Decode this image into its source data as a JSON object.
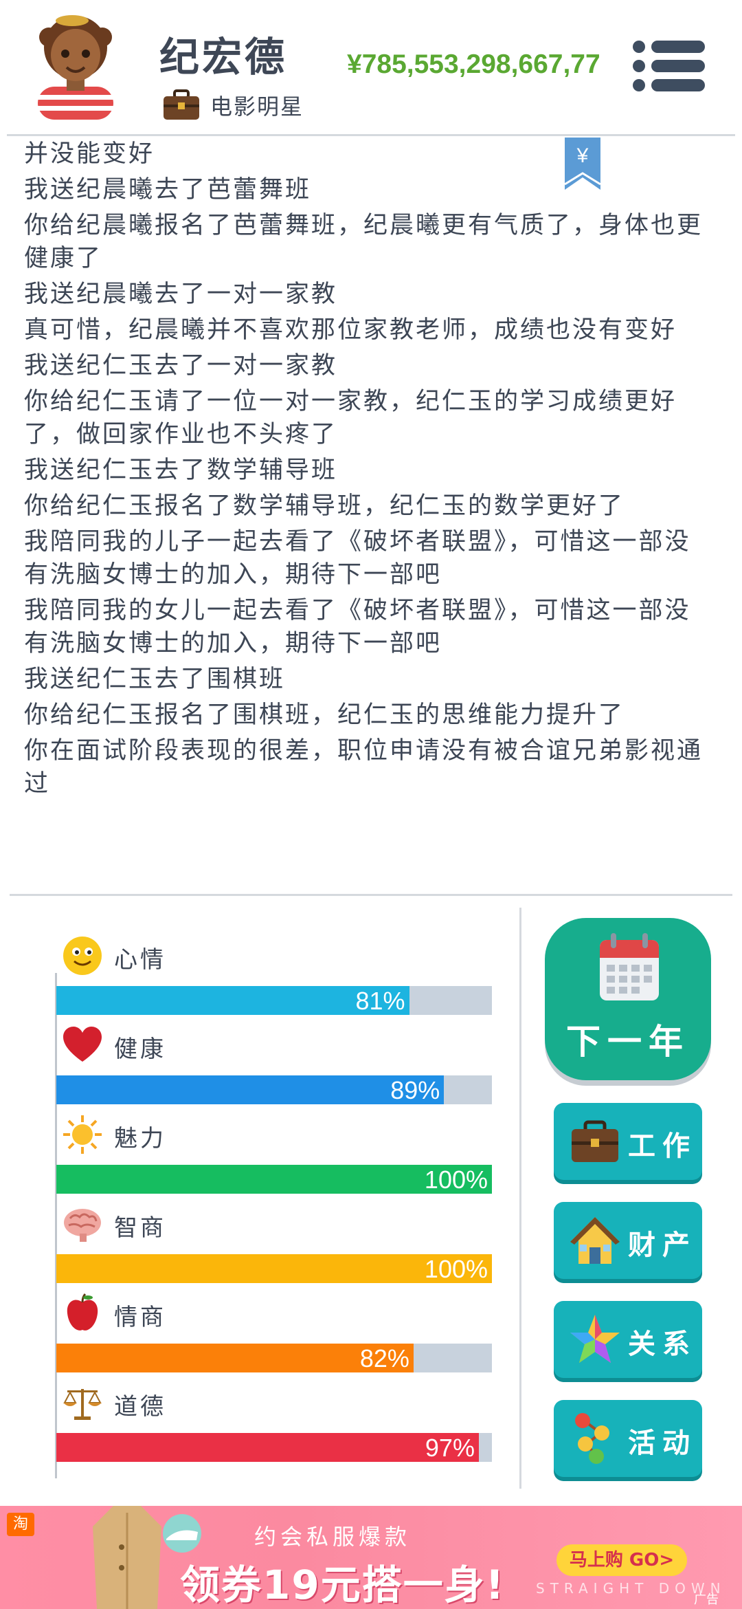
{
  "header": {
    "name": "纪宏德",
    "job": "电影明星",
    "money": "¥785,553,298,667,77"
  },
  "bookmark_symbol": "¥",
  "log": [
    "并没能变好",
    "我送纪晨曦去了芭蕾舞班",
    "你给纪晨曦报名了芭蕾舞班，纪晨曦更有气质了，身体也更健康了",
    "我送纪晨曦去了一对一家教",
    "真可惜，纪晨曦并不喜欢那位家教老师，成绩也没有变好",
    "我送纪仁玉去了一对一家教",
    "你给纪仁玉请了一位一对一家教，纪仁玉的学习成绩更好了，做回家作业也不头疼了",
    "我送纪仁玉去了数学辅导班",
    "你给纪仁玉报名了数学辅导班，纪仁玉的数学更好了",
    "我陪同我的儿子一起去看了《破坏者联盟》，可惜这一部没有洗脑女博士的加入，期待下一部吧",
    "我陪同我的女儿一起去看了《破坏者联盟》，可惜这一部没有洗脑女博士的加入，期待下一部吧",
    "我送纪仁玉去了围棋班",
    "你给纪仁玉报名了围棋班，纪仁玉的思维能力提升了",
    "你在面试阶段表现的很差，职位申请没有被合谊兄弟影视通过"
  ],
  "stats": [
    {
      "label": "心情",
      "value": 81,
      "pct": "81%",
      "color": "#1db4e0",
      "icon": "smiley-icon"
    },
    {
      "label": "健康",
      "value": 89,
      "pct": "89%",
      "color": "#1f8fe6",
      "icon": "heart-icon"
    },
    {
      "label": "魅力",
      "value": 100,
      "pct": "100%",
      "color": "#16bd60",
      "icon": "sun-icon"
    },
    {
      "label": "智商",
      "value": 100,
      "pct": "100%",
      "color": "#fbb60a",
      "icon": "brain-icon"
    },
    {
      "label": "情商",
      "value": 82,
      "pct": "82%",
      "color": "#fb8009",
      "icon": "apple-icon"
    },
    {
      "label": "道德",
      "value": 97,
      "pct": "97%",
      "color": "#ea3045",
      "icon": "scales-icon"
    }
  ],
  "buttons": {
    "next_year": "下一年",
    "work": "工作",
    "property": "财产",
    "relations": "关系",
    "activities": "活动"
  },
  "ad": {
    "badge": "淘",
    "headline": "约会私服爆款",
    "coupon": "领券19元搭一身!",
    "buy": "马上购 GO>",
    "sub": "STRAIGHT DOWN",
    "tag": "广告"
  }
}
